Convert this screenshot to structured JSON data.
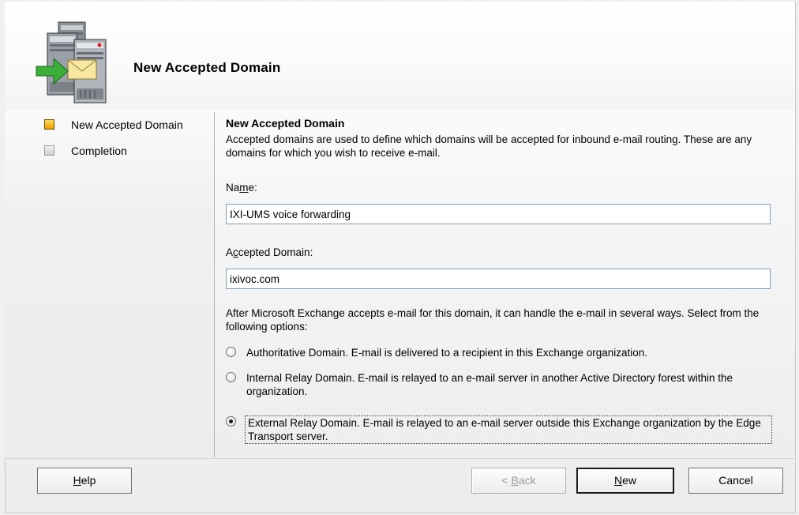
{
  "wizard": {
    "title": "New Accepted Domain"
  },
  "nav": {
    "items": [
      {
        "label": "New Accepted Domain",
        "state": "active"
      },
      {
        "label": "Completion",
        "state": "inactive"
      }
    ]
  },
  "main": {
    "section_title": "New Accepted Domain",
    "description": "Accepted domains are used to define which domains will be accepted for inbound e-mail routing.  These are any domains for which you wish to receive e-mail.",
    "name_label": "Name:",
    "name_value": "IXI-UMS voice forwarding",
    "domain_label": "Accepted Domain:",
    "domain_value": "ixivoc.com",
    "options_intro": "After Microsoft Exchange accepts e-mail for this domain, it can handle the e-mail in several ways. Select from the following options:",
    "options": [
      {
        "label": "Authoritative Domain. E-mail is delivered to a recipient in this Exchange organization.",
        "selected": false
      },
      {
        "label": "Internal Relay Domain. E-mail is relayed to an e-mail server in another Active Directory forest within the organization.",
        "selected": false
      },
      {
        "label": "External Relay Domain. E-mail is relayed to an e-mail server outside this Exchange organization by the Edge Transport server.",
        "selected": true
      }
    ]
  },
  "buttons": {
    "help": "Help",
    "back": "< Back",
    "new": "New",
    "cancel": "Cancel"
  },
  "icons": {
    "wizard_icon": "server-mail-icon"
  },
  "colors": {
    "active_marker": "#f2a300",
    "input_border": "#7f9db9"
  }
}
